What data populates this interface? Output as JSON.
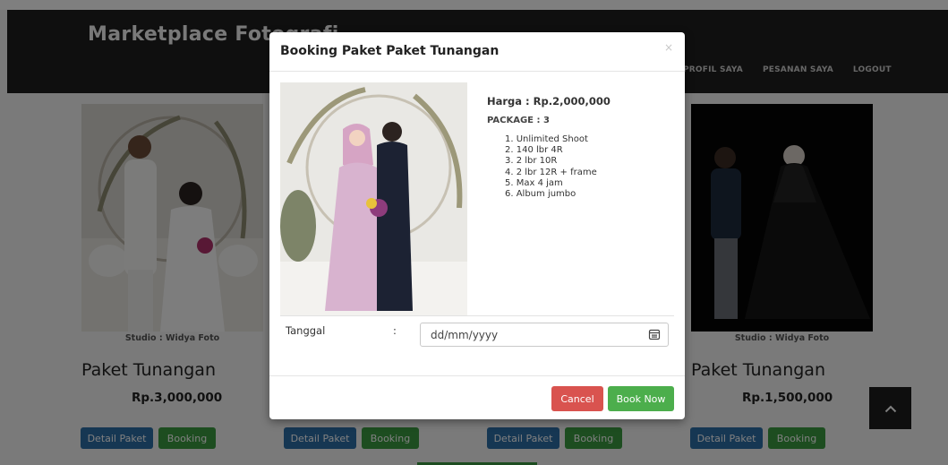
{
  "brand": "Marketplace Fotografi",
  "nav": [
    "PROFIL SAYA",
    "PESANAN SAYA",
    "LOGOUT"
  ],
  "cards": [
    {
      "studio": "Studio : Widya Foto",
      "title": "Paket Tunangan",
      "price": "Rp.3,000,000",
      "detail_label": "Detail Paket",
      "booking_label": "Booking"
    },
    {
      "studio": "",
      "title": "",
      "price": "",
      "detail_label": "Detail Paket",
      "booking_label": "Booking"
    },
    {
      "studio": "",
      "title": "",
      "price": "",
      "detail_label": "Detail Paket",
      "booking_label": "Booking"
    },
    {
      "studio": "Studio : Widya Foto",
      "title": "Paket Tunangan",
      "price": "Rp.1,500,000",
      "detail_label": "Detail Paket",
      "booking_label": "Booking"
    }
  ],
  "modal": {
    "title": "Booking Paket Paket Tunangan",
    "close": "×",
    "price": "Harga : Rp.2,000,000",
    "package": "PACKAGE : 3",
    "items": [
      "1. Unlimited Shoot",
      "2. 140 lbr 4R",
      "3. 2 lbr 10R",
      "4. 2 lbr 12R  + frame",
      "5. Max 4 jam",
      "6. Album jumbo"
    ],
    "date_label": "Tanggal",
    "date_colon": ":",
    "date_placeholder": "dd/mm/yyyy",
    "cancel_label": "Cancel",
    "book_label": "Book Now"
  },
  "colors": {
    "navbar": "#1e1e1e",
    "detail_button": "#2d6ea7",
    "booking_button": "#3b9b40",
    "cancel_button": "#d9534f",
    "book_now_button": "#4cae4c"
  },
  "icons": [
    "close-icon",
    "calendar-icon",
    "chevron-up-icon"
  ]
}
